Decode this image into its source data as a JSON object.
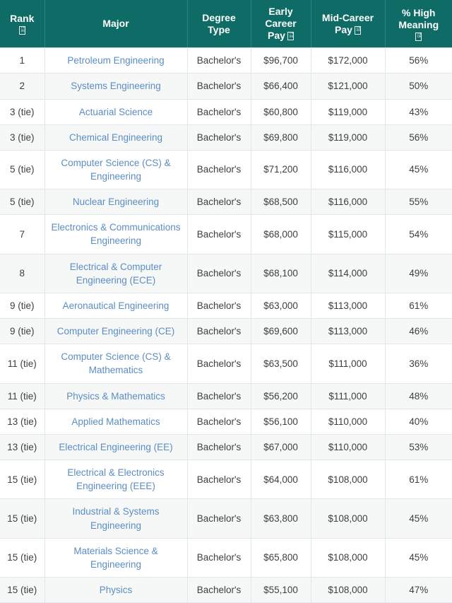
{
  "table": {
    "accent_color": "#0e6b66",
    "link_color": "#5b8dc4",
    "stripe_color": "#f6f8f8",
    "border_color": "#e2e6e8",
    "columns": [
      {
        "key": "rank",
        "label": "Rank",
        "icon": "sort-icon",
        "icon_hex": "F0\nD8",
        "icon_position": "below"
      },
      {
        "key": "major",
        "label": "Major",
        "icon": null,
        "icon_hex": "",
        "icon_position": "none"
      },
      {
        "key": "degree",
        "label": "Degree\nType",
        "icon": null,
        "icon_hex": "",
        "icon_position": "none"
      },
      {
        "key": "early",
        "label": "Early\nCareer\nPay",
        "icon": "sort-icon",
        "icon_hex": "F0\nD8",
        "icon_position": "inline"
      },
      {
        "key": "mid",
        "label": "Mid-Career\nPay",
        "icon": "sort-desc-icon",
        "icon_hex": "F0\nDD",
        "icon_position": "inline"
      },
      {
        "key": "meaning",
        "label": "% High\nMeaning",
        "icon": "sort-icon",
        "icon_hex": "F0\nD8",
        "icon_position": "below"
      }
    ],
    "column_labels": {
      "rank": "Rank",
      "major": "Major",
      "degree_line1": "Degree",
      "degree_line2": "Type",
      "early_line1": "Early",
      "early_line2": "Career",
      "early_line3": "Pay",
      "mid_line1": "Mid-Career",
      "mid_line2": "Pay",
      "meaning_line1": "% High",
      "meaning_line2": "Meaning"
    },
    "rows": [
      {
        "rank": "1",
        "major": "Petroleum Engineering",
        "degree": "Bachelor's",
        "early": "$96,700",
        "mid": "$172,000",
        "meaning": "56%"
      },
      {
        "rank": "2",
        "major": "Systems Engineering",
        "degree": "Bachelor's",
        "early": "$66,400",
        "mid": "$121,000",
        "meaning": "50%"
      },
      {
        "rank": "3 (tie)",
        "major": "Actuarial Science",
        "degree": "Bachelor's",
        "early": "$60,800",
        "mid": "$119,000",
        "meaning": "43%"
      },
      {
        "rank": "3 (tie)",
        "major": "Chemical Engineering",
        "degree": "Bachelor's",
        "early": "$69,800",
        "mid": "$119,000",
        "meaning": "56%"
      },
      {
        "rank": "5 (tie)",
        "major": "Computer Science (CS) & Engineering",
        "degree": "Bachelor's",
        "early": "$71,200",
        "mid": "$116,000",
        "meaning": "45%"
      },
      {
        "rank": "5 (tie)",
        "major": "Nuclear Engineering",
        "degree": "Bachelor's",
        "early": "$68,500",
        "mid": "$116,000",
        "meaning": "55%"
      },
      {
        "rank": "7",
        "major": "Electronics & Communications Engineering",
        "degree": "Bachelor's",
        "early": "$68,000",
        "mid": "$115,000",
        "meaning": "54%"
      },
      {
        "rank": "8",
        "major": "Electrical & Computer Engineering (ECE)",
        "degree": "Bachelor's",
        "early": "$68,100",
        "mid": "$114,000",
        "meaning": "49%"
      },
      {
        "rank": "9 (tie)",
        "major": "Aeronautical Engineering",
        "degree": "Bachelor's",
        "early": "$63,000",
        "mid": "$113,000",
        "meaning": "61%"
      },
      {
        "rank": "9 (tie)",
        "major": "Computer Engineering (CE)",
        "degree": "Bachelor's",
        "early": "$69,600",
        "mid": "$113,000",
        "meaning": "46%"
      },
      {
        "rank": "11 (tie)",
        "major": "Computer Science (CS) & Mathematics",
        "degree": "Bachelor's",
        "early": "$63,500",
        "mid": "$111,000",
        "meaning": "36%"
      },
      {
        "rank": "11 (tie)",
        "major": "Physics & Mathematics",
        "degree": "Bachelor's",
        "early": "$56,200",
        "mid": "$111,000",
        "meaning": "48%"
      },
      {
        "rank": "13 (tie)",
        "major": "Applied Mathematics",
        "degree": "Bachelor's",
        "early": "$56,100",
        "mid": "$110,000",
        "meaning": "40%"
      },
      {
        "rank": "13 (tie)",
        "major": "Electrical Engineering (EE)",
        "degree": "Bachelor's",
        "early": "$67,000",
        "mid": "$110,000",
        "meaning": "53%"
      },
      {
        "rank": "15 (tie)",
        "major": "Electrical & Electronics Engineering (EEE)",
        "degree": "Bachelor's",
        "early": "$64,000",
        "mid": "$108,000",
        "meaning": "61%"
      },
      {
        "rank": "15 (tie)",
        "major": "Industrial & Systems Engineering",
        "degree": "Bachelor's",
        "early": "$63,800",
        "mid": "$108,000",
        "meaning": "45%"
      },
      {
        "rank": "15 (tie)",
        "major": "Materials Science & Engineering",
        "degree": "Bachelor's",
        "early": "$65,800",
        "mid": "$108,000",
        "meaning": "45%"
      },
      {
        "rank": "15 (tie)",
        "major": "Physics",
        "degree": "Bachelor's",
        "early": "$55,100",
        "mid": "$108,000",
        "meaning": "47%"
      }
    ]
  }
}
